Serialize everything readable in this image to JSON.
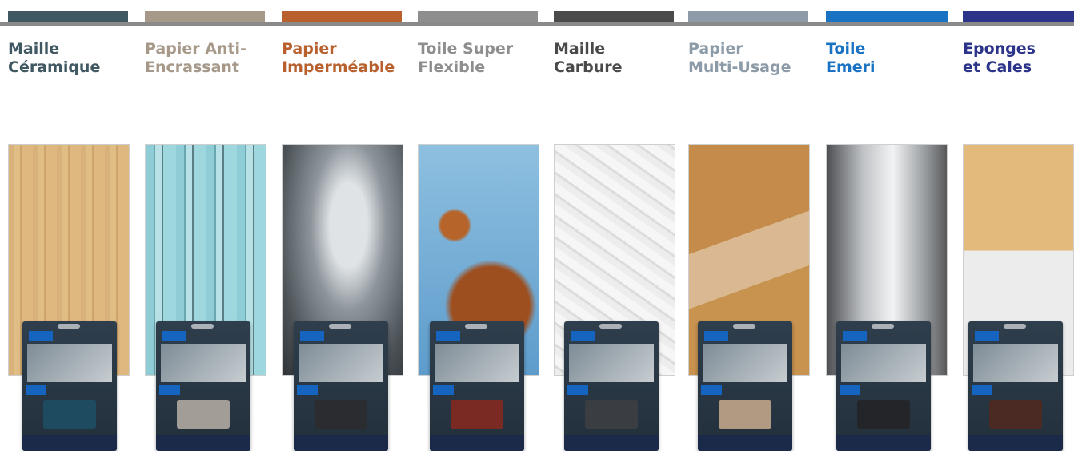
{
  "categories": [
    {
      "title": "Maille\nCéramique",
      "color": "#3f5862",
      "photo": "light-wood",
      "sheet_color": "#1e4b5f"
    },
    {
      "title": "Papier Anti-\nEncrassant",
      "color": "#a6998a",
      "photo": "peeling-turquoise-paint",
      "sheet_color": "#a29d96"
    },
    {
      "title": "Papier\nImperméable",
      "color": "#b8612f",
      "photo": "car-door-handle",
      "sheet_color": "#2a2c30"
    },
    {
      "title": "Toile Super\nFlexible",
      "color": "#8e8e8e",
      "photo": "rusty-blue-metal",
      "sheet_color": "#7a2a22"
    },
    {
      "title": "Maille\nCarbure",
      "color": "#4a4a4a",
      "photo": "white-plaster",
      "sheet_color": "#3a3d42"
    },
    {
      "title": "Papier\nMulti-Usage",
      "color": "#8c9ba7",
      "photo": "oak-wood-sanded",
      "sheet_color": "#b09a82"
    },
    {
      "title": "Toile\nEmeri",
      "color": "#1a73c2",
      "photo": "brushed-metal",
      "sheet_color": "#232529"
    },
    {
      "title": "Eponges\net Cales",
      "color": "#2b3489",
      "photo": "wood-and-plaster",
      "sheet_color": "#4a2a22"
    }
  ],
  "brand_icon": "norton-logo-icon"
}
